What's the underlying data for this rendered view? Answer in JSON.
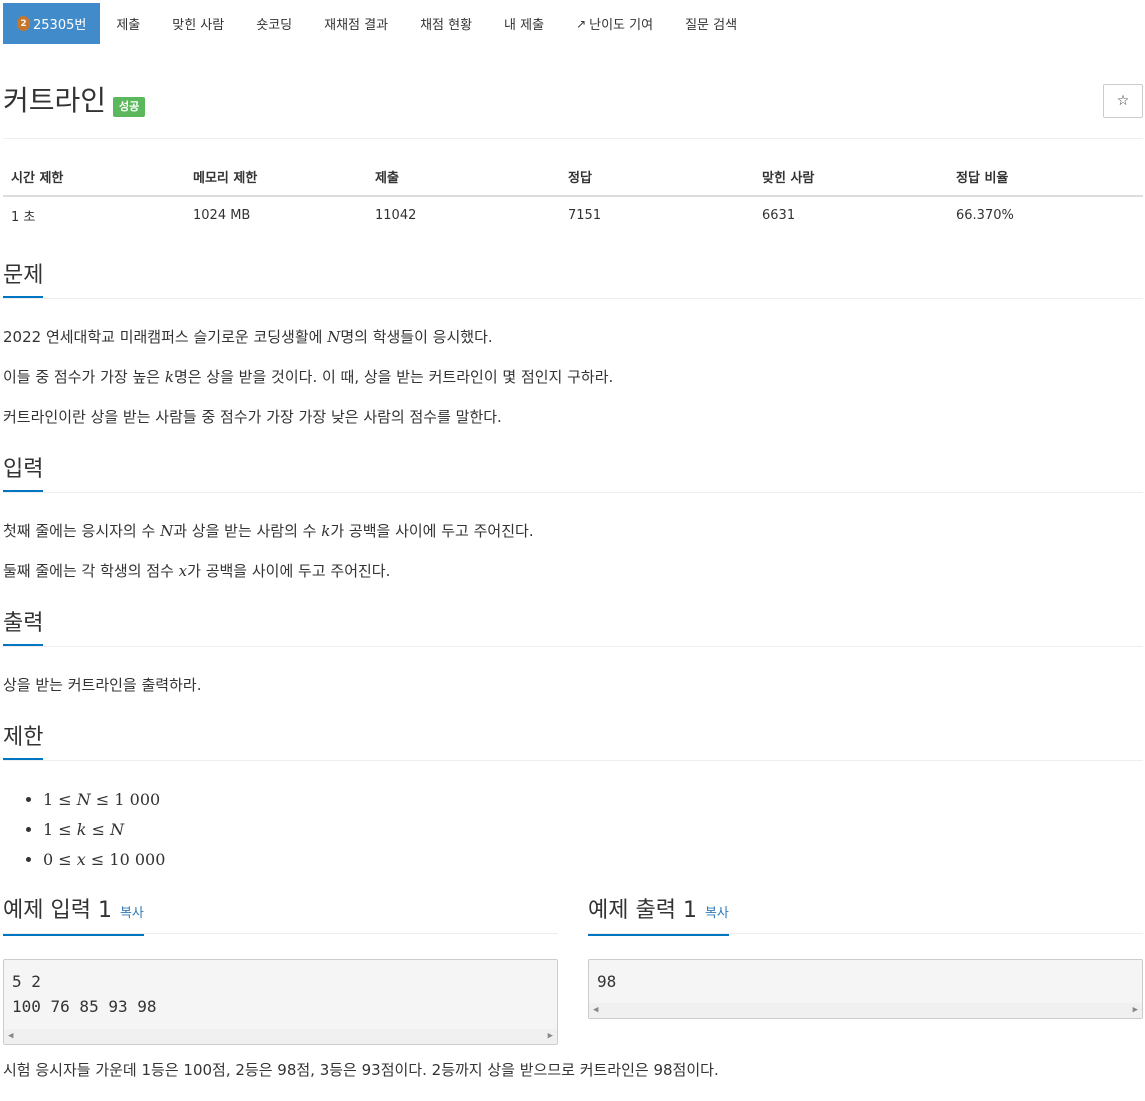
{
  "nav": {
    "problem_badge": "2",
    "problem_tab": "25305번",
    "tabs": [
      "제출",
      "맞힌 사람",
      "숏코딩",
      "재채점 결과",
      "채점 현황",
      "내 제출",
      "난이도 기여",
      "질문 검색"
    ]
  },
  "title": "커트라인",
  "status": "성공",
  "star": "☆",
  "stats": {
    "headers": [
      "시간 제한",
      "메모리 제한",
      "제출",
      "정답",
      "맞힌 사람",
      "정답 비율"
    ],
    "values": [
      "1 초",
      "1024 MB",
      "11042",
      "7151",
      "6631",
      "66.370%"
    ]
  },
  "sections": {
    "problem": "문제",
    "input": "입력",
    "output": "출력",
    "limit": "제한",
    "sample_input": "예제 입력 1",
    "sample_output": "예제 출력 1",
    "copy": "복사"
  },
  "problem_text": {
    "p1a": "2022 연세대학교 미래캠퍼스 슬기로운 코딩생활에 ",
    "p1var": "N",
    "p1b": "명의 학생들이 응시했다.",
    "p2a": "이들 중 점수가 가장 높은 ",
    "p2var": "k",
    "p2b": "명은 상을 받을 것이다. 이 때, 상을 받는 커트라인이 몇 점인지 구하라.",
    "p3": "커트라인이란 상을 받는 사람들 중 점수가 가장 가장 낮은 사람의 점수를 말한다."
  },
  "input_text": {
    "p1a": "첫째 줄에는 응시자의 수 ",
    "p1var1": "N",
    "p1b": "과 상을 받는 사람의 수 ",
    "p1var2": "k",
    "p1c": "가 공백을 사이에 두고 주어진다.",
    "p2a": "둘째 줄에는 각 학생의 점수 ",
    "p2var": "x",
    "p2b": "가 공백을 사이에 두고 주어진다."
  },
  "output_text": "상을 받는 커트라인을 출력하라.",
  "limits": [
    {
      "a": "1",
      "op1": "≤",
      "v": "N",
      "op2": "≤",
      "b": "1 000"
    },
    {
      "a": "1",
      "op1": "≤",
      "v": "k",
      "op2": "≤",
      "b": "N"
    },
    {
      "a": "0",
      "op1": "≤",
      "v": "x",
      "op2": "≤",
      "b": "10 000"
    }
  ],
  "sample_input": "5 2\n100 76 85 93 98",
  "sample_output": "98",
  "note": "시험 응시자들 가운데 1등은 100점, 2등은 98점, 3등은 93점이다. 2등까지 상을 받으므로 커트라인은 98점이다."
}
